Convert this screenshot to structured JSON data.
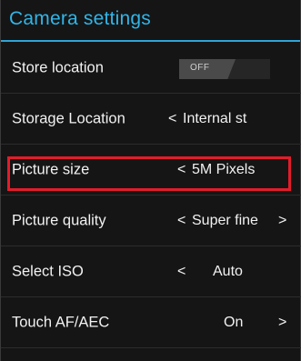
{
  "header": {
    "title": "Camera settings"
  },
  "accent_color": "#31b5e8",
  "highlight_color": "#e21c2a",
  "rows": [
    {
      "label": "Store location",
      "value": "OFF"
    },
    {
      "label": "Storage Location",
      "left_arrow": "<",
      "value": "Internal st"
    },
    {
      "label": "Picture size",
      "left_arrow": "<",
      "value": "5M Pixels"
    },
    {
      "label": "Picture quality",
      "left_arrow": "<",
      "value": "Super fine",
      "right_arrow": ">"
    },
    {
      "label": "Select ISO",
      "left_arrow": "<",
      "value": "Auto"
    },
    {
      "label": "Touch AF/AEC",
      "value": "On",
      "right_arrow": ">"
    }
  ]
}
